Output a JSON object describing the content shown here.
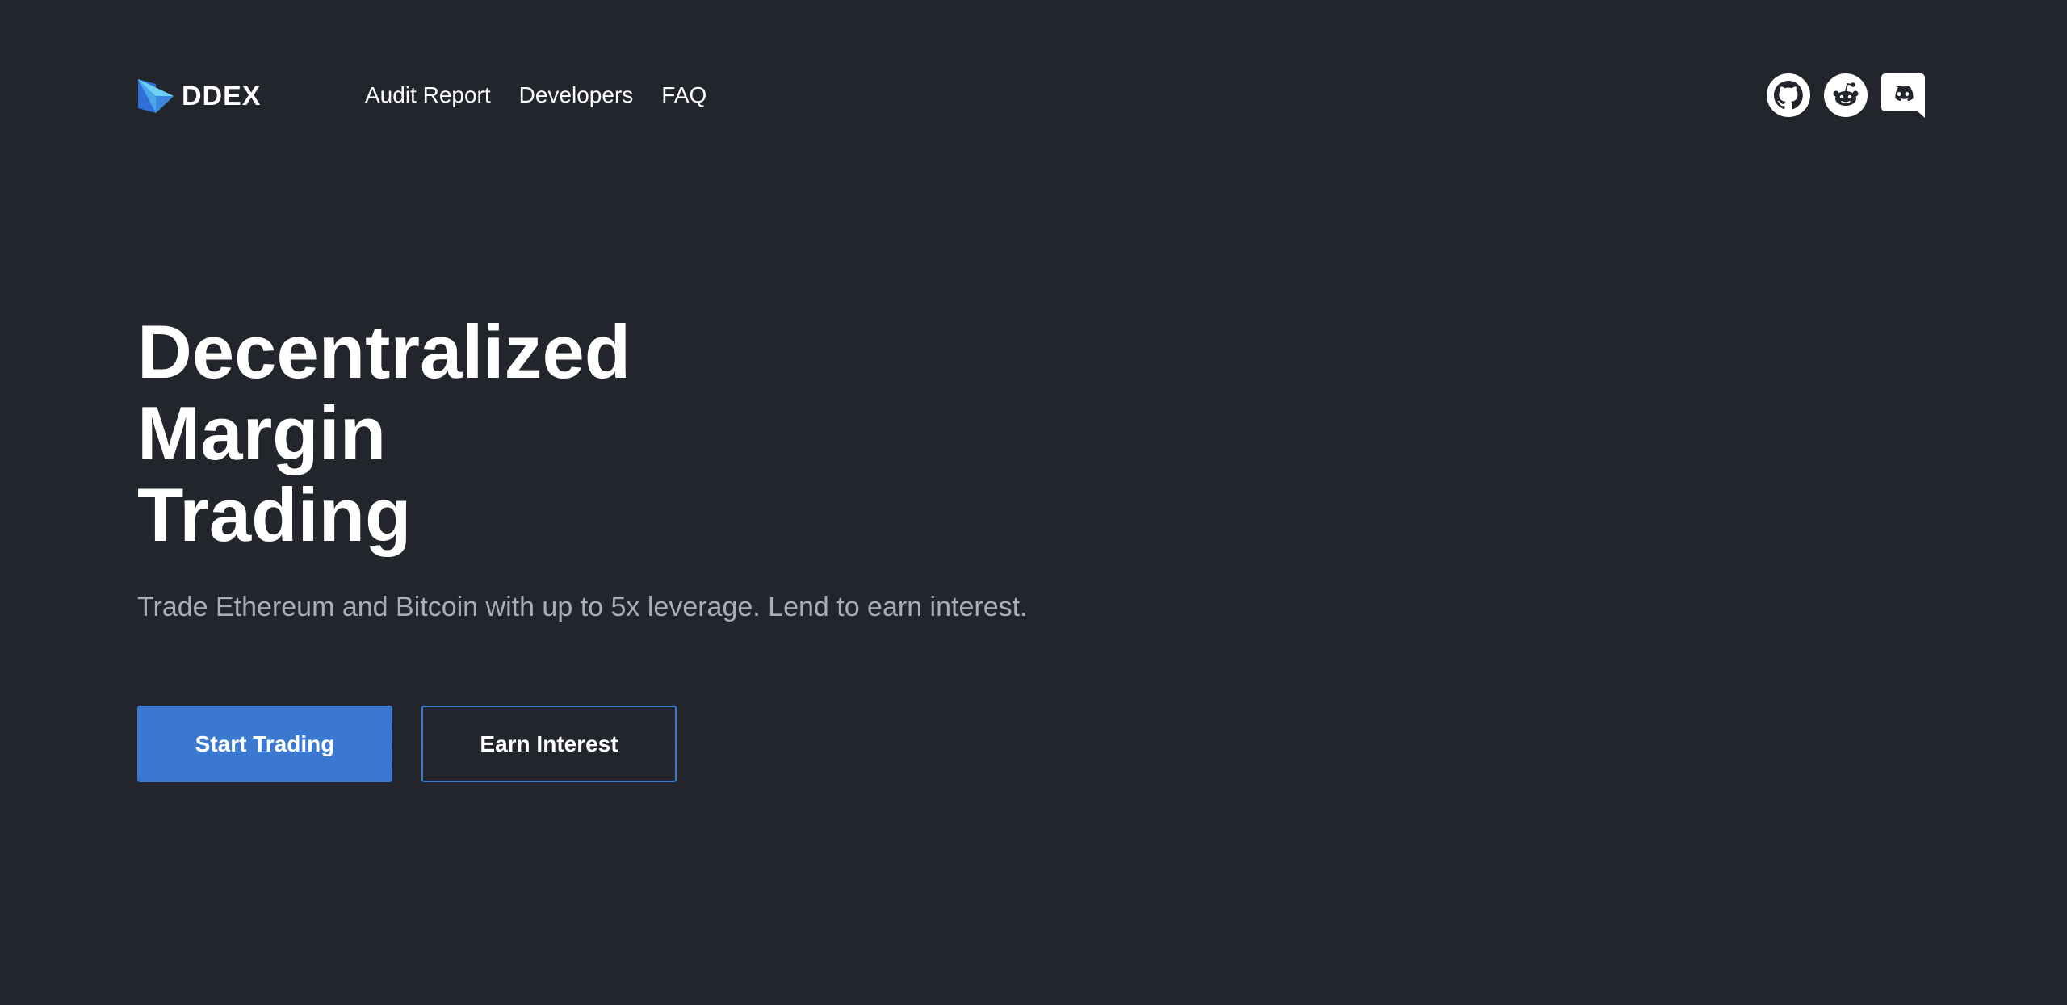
{
  "brand": {
    "name": "DDEX",
    "logo_icon": "ddex-cube-logo-icon",
    "colors": {
      "background": "#22252b",
      "accent": "#3b79d0",
      "text": "#ffffff",
      "subtitle": "#a9adb6"
    }
  },
  "nav": {
    "items": [
      {
        "label": "Audit Report"
      },
      {
        "label": "Developers"
      },
      {
        "label": "FAQ"
      }
    ]
  },
  "social": {
    "icons": [
      "github-icon",
      "reddit-icon",
      "discord-icon"
    ]
  },
  "hero": {
    "title_lines": [
      "Decentralized",
      "Margin",
      "Trading"
    ],
    "subtitle": "Trade Ethereum and Bitcoin with up to 5x leverage. Lend to earn interest.",
    "primary_button": "Start Trading",
    "secondary_button": "Earn Interest"
  }
}
